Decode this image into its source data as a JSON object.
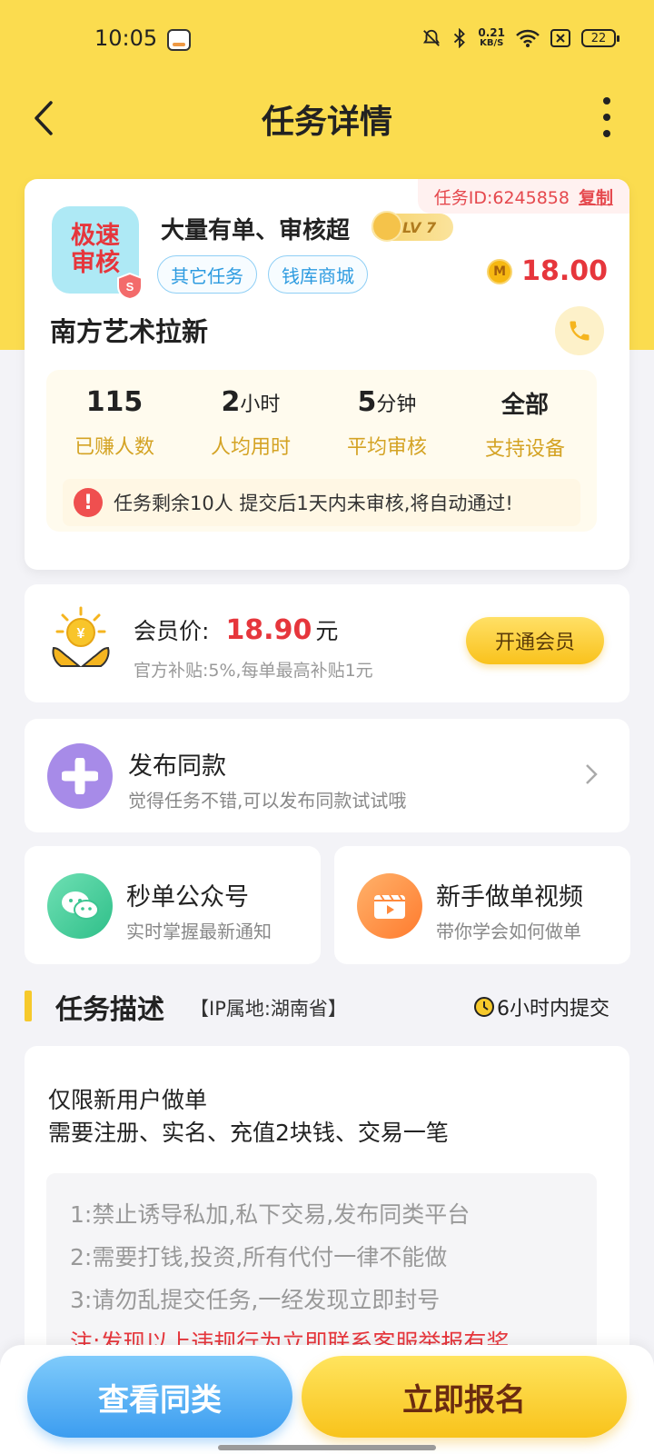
{
  "status_bar": {
    "time": "10:05",
    "net_speed_value": "0.21",
    "net_speed_unit": "KB/S",
    "battery": "22"
  },
  "nav": {
    "title": "任务详情"
  },
  "task": {
    "id_label": "任务ID:6245858",
    "copy_label": "复制",
    "logo_text": "极速审核",
    "name": "大量有单、审核超",
    "level": "LV 7",
    "tags": [
      "其它任务",
      "钱库商城"
    ],
    "coin_symbol": "M",
    "price": "18.00",
    "sub_name": "南方艺术拉新",
    "stats": [
      {
        "value": "115",
        "unit": "",
        "label": "已赚人数"
      },
      {
        "value": "2",
        "unit": "小时",
        "label": "人均用时"
      },
      {
        "value": "5",
        "unit": "分钟",
        "label": "平均审核"
      },
      {
        "value": "全部",
        "unit": "",
        "label": "支持设备"
      }
    ],
    "notice": "任务剩余10人  提交后1天内未审核,将自动通过!"
  },
  "member": {
    "label": "会员价:",
    "price": "18.90",
    "unit": "元",
    "sub": "官方补贴:5%,每单最高补贴1元",
    "button": "开通会员"
  },
  "publish": {
    "title": "发布同款",
    "sub": "觉得任务不错,可以发布同款试试哦"
  },
  "shortcuts": [
    {
      "title": "秒单公众号",
      "sub": "实时掌握最新通知"
    },
    {
      "title": "新手做单视频",
      "sub": "带你学会如何做单"
    }
  ],
  "description": {
    "heading": "任务描述",
    "ip": "【IP属地:湖南省】",
    "deadline": "6小时内提交",
    "lines": [
      "仅限新用户做单",
      "需要注册、实名、充值2块钱、交易一笔"
    ],
    "rules": [
      "1:禁止诱导私加,私下交易,发布同类平台",
      "2:需要打钱,投资,所有代付一律不能做",
      "3:请勿乱提交任务,一经发现立即封号"
    ],
    "warning": "注:发现以上违规行为立即联系客服举报有奖"
  },
  "bottom": {
    "similar": "查看同类",
    "signup": "立即报名"
  },
  "colors": {
    "brand_yellow": "#fbdc4f",
    "price_red": "#e6363c",
    "tag_blue": "#2d9be0"
  }
}
